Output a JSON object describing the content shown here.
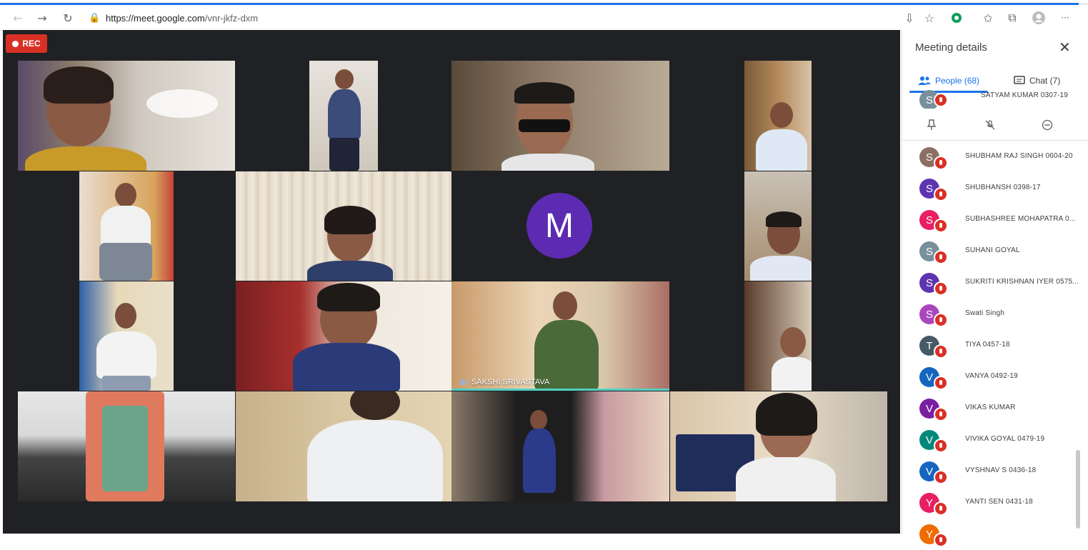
{
  "browser": {
    "url_host": "https://meet.google.com",
    "url_path": "/vnr-jkfz-dxm",
    "back_icon": "←",
    "forward_icon": "→",
    "reload_icon": "↻",
    "more_icon": "···"
  },
  "meeting": {
    "rec_label": "REC",
    "avatar_letter": "M",
    "speaker_label": "SAKSHI SRIVASTAVA"
  },
  "panel": {
    "title": "Meeting details",
    "tabs": [
      {
        "label": "People (68)",
        "icon": "people-icon"
      },
      {
        "label": "Chat (7)",
        "icon": "chat-icon"
      }
    ],
    "top_cut_name": "SATYAM KUMAR 0307-19",
    "top_cut_letter": "S",
    "participants": [
      {
        "letter": "S",
        "name": "SHUBHAM RAJ SINGH 0604-20",
        "color": "#8d6e63"
      },
      {
        "letter": "S",
        "name": "SHUBHANSH 0398-17",
        "color": "#5e35b1"
      },
      {
        "letter": "S",
        "name": "SUBHASHREE MOHAPATRA 0...",
        "color": "#e91e63"
      },
      {
        "letter": "S",
        "name": "SUHANI GOYAL",
        "color": "#78909c"
      },
      {
        "letter": "S",
        "name": "SUKRITI KRISHNAN IYER 0575...",
        "color": "#5e35b1"
      },
      {
        "letter": "S",
        "name": "Swati Singh",
        "color": "#ab47bc"
      },
      {
        "letter": "T",
        "name": "TIYA 0457-18",
        "color": "#455a64"
      },
      {
        "letter": "V",
        "name": "VANYA 0492-19",
        "color": "#1565c0"
      },
      {
        "letter": "V",
        "name": "VIKAS KUMAR",
        "color": "#7b1fa2"
      },
      {
        "letter": "V",
        "name": "VIVIKA GOYAL 0479-19",
        "color": "#00897b"
      },
      {
        "letter": "V",
        "name": "VYSHNAV S 0436-18",
        "color": "#1565c0"
      },
      {
        "letter": "Y",
        "name": "YANTI SEN 0431-18",
        "color": "#e91e63"
      },
      {
        "letter": "Y",
        "name": "",
        "color": "#ef6c00"
      }
    ]
  },
  "colors": {
    "accent": "#1a73e8",
    "rec": "#d93025",
    "stage": "#202124",
    "avatar": "#5c2bb1"
  }
}
